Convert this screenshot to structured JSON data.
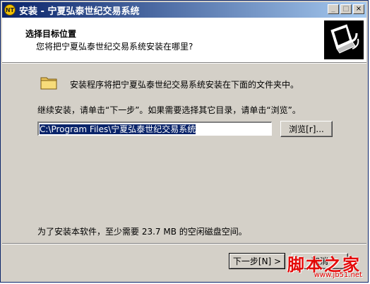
{
  "window": {
    "title": "安装 - 宁夏弘泰世纪交易系统",
    "app_icon_text": "NT",
    "minimize_glyph": "_",
    "maximize_glyph": "□",
    "close_glyph": "×"
  },
  "header": {
    "title": "选择目标位置",
    "subtitle": "您将把宁夏弘泰世纪交易系统安装在哪里?"
  },
  "body": {
    "intro": "安装程序将把宁夏弘泰世纪交易系统安装在下面的文件夹中。",
    "continue_hint": "继续安装，请单击“下一步”。如果需要选择其它目录，请单击“浏览”。",
    "path_value": "C:\\Program Files\\宁夏弘泰世纪交易系统",
    "browse_label": "浏览[r]...",
    "space_required": "为了安装本软件，至少需要 23.7 MB 的空闲磁盘空间。"
  },
  "footer": {
    "next_label": "下一步[N] >",
    "cancel_label": "取消"
  },
  "watermark": {
    "text": "脚本之家",
    "url": "www.jb51.net"
  }
}
